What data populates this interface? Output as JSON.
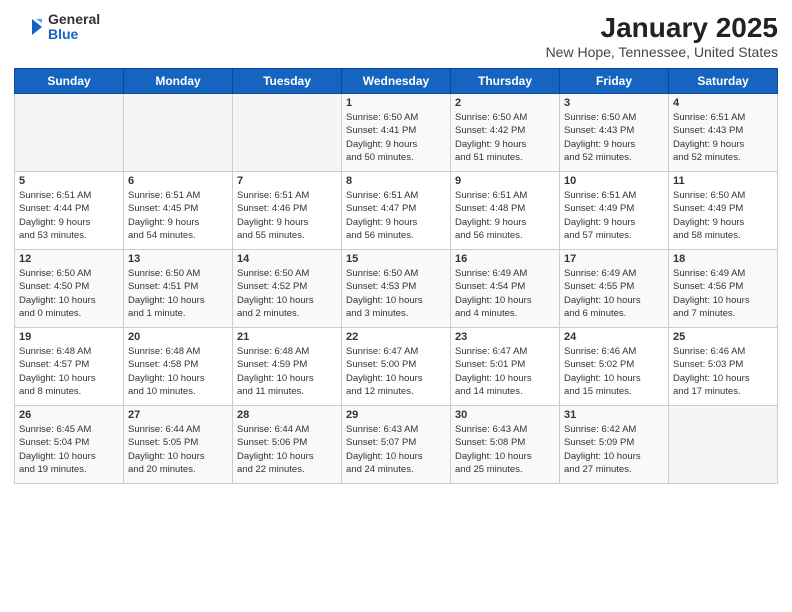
{
  "logo": {
    "general": "General",
    "blue": "Blue"
  },
  "title": "January 2025",
  "subtitle": "New Hope, Tennessee, United States",
  "days_header": [
    "Sunday",
    "Monday",
    "Tuesday",
    "Wednesday",
    "Thursday",
    "Friday",
    "Saturday"
  ],
  "weeks": [
    [
      {
        "day": "",
        "info": ""
      },
      {
        "day": "",
        "info": ""
      },
      {
        "day": "",
        "info": ""
      },
      {
        "day": "1",
        "info": "Sunrise: 6:50 AM\nSunset: 4:41 PM\nDaylight: 9 hours\nand 50 minutes."
      },
      {
        "day": "2",
        "info": "Sunrise: 6:50 AM\nSunset: 4:42 PM\nDaylight: 9 hours\nand 51 minutes."
      },
      {
        "day": "3",
        "info": "Sunrise: 6:50 AM\nSunset: 4:43 PM\nDaylight: 9 hours\nand 52 minutes."
      },
      {
        "day": "4",
        "info": "Sunrise: 6:51 AM\nSunset: 4:43 PM\nDaylight: 9 hours\nand 52 minutes."
      }
    ],
    [
      {
        "day": "5",
        "info": "Sunrise: 6:51 AM\nSunset: 4:44 PM\nDaylight: 9 hours\nand 53 minutes."
      },
      {
        "day": "6",
        "info": "Sunrise: 6:51 AM\nSunset: 4:45 PM\nDaylight: 9 hours\nand 54 minutes."
      },
      {
        "day": "7",
        "info": "Sunrise: 6:51 AM\nSunset: 4:46 PM\nDaylight: 9 hours\nand 55 minutes."
      },
      {
        "day": "8",
        "info": "Sunrise: 6:51 AM\nSunset: 4:47 PM\nDaylight: 9 hours\nand 56 minutes."
      },
      {
        "day": "9",
        "info": "Sunrise: 6:51 AM\nSunset: 4:48 PM\nDaylight: 9 hours\nand 56 minutes."
      },
      {
        "day": "10",
        "info": "Sunrise: 6:51 AM\nSunset: 4:49 PM\nDaylight: 9 hours\nand 57 minutes."
      },
      {
        "day": "11",
        "info": "Sunrise: 6:50 AM\nSunset: 4:49 PM\nDaylight: 9 hours\nand 58 minutes."
      }
    ],
    [
      {
        "day": "12",
        "info": "Sunrise: 6:50 AM\nSunset: 4:50 PM\nDaylight: 10 hours\nand 0 minutes."
      },
      {
        "day": "13",
        "info": "Sunrise: 6:50 AM\nSunset: 4:51 PM\nDaylight: 10 hours\nand 1 minute."
      },
      {
        "day": "14",
        "info": "Sunrise: 6:50 AM\nSunset: 4:52 PM\nDaylight: 10 hours\nand 2 minutes."
      },
      {
        "day": "15",
        "info": "Sunrise: 6:50 AM\nSunset: 4:53 PM\nDaylight: 10 hours\nand 3 minutes."
      },
      {
        "day": "16",
        "info": "Sunrise: 6:49 AM\nSunset: 4:54 PM\nDaylight: 10 hours\nand 4 minutes."
      },
      {
        "day": "17",
        "info": "Sunrise: 6:49 AM\nSunset: 4:55 PM\nDaylight: 10 hours\nand 6 minutes."
      },
      {
        "day": "18",
        "info": "Sunrise: 6:49 AM\nSunset: 4:56 PM\nDaylight: 10 hours\nand 7 minutes."
      }
    ],
    [
      {
        "day": "19",
        "info": "Sunrise: 6:48 AM\nSunset: 4:57 PM\nDaylight: 10 hours\nand 8 minutes."
      },
      {
        "day": "20",
        "info": "Sunrise: 6:48 AM\nSunset: 4:58 PM\nDaylight: 10 hours\nand 10 minutes."
      },
      {
        "day": "21",
        "info": "Sunrise: 6:48 AM\nSunset: 4:59 PM\nDaylight: 10 hours\nand 11 minutes."
      },
      {
        "day": "22",
        "info": "Sunrise: 6:47 AM\nSunset: 5:00 PM\nDaylight: 10 hours\nand 12 minutes."
      },
      {
        "day": "23",
        "info": "Sunrise: 6:47 AM\nSunset: 5:01 PM\nDaylight: 10 hours\nand 14 minutes."
      },
      {
        "day": "24",
        "info": "Sunrise: 6:46 AM\nSunset: 5:02 PM\nDaylight: 10 hours\nand 15 minutes."
      },
      {
        "day": "25",
        "info": "Sunrise: 6:46 AM\nSunset: 5:03 PM\nDaylight: 10 hours\nand 17 minutes."
      }
    ],
    [
      {
        "day": "26",
        "info": "Sunrise: 6:45 AM\nSunset: 5:04 PM\nDaylight: 10 hours\nand 19 minutes."
      },
      {
        "day": "27",
        "info": "Sunrise: 6:44 AM\nSunset: 5:05 PM\nDaylight: 10 hours\nand 20 minutes."
      },
      {
        "day": "28",
        "info": "Sunrise: 6:44 AM\nSunset: 5:06 PM\nDaylight: 10 hours\nand 22 minutes."
      },
      {
        "day": "29",
        "info": "Sunrise: 6:43 AM\nSunset: 5:07 PM\nDaylight: 10 hours\nand 24 minutes."
      },
      {
        "day": "30",
        "info": "Sunrise: 6:43 AM\nSunset: 5:08 PM\nDaylight: 10 hours\nand 25 minutes."
      },
      {
        "day": "31",
        "info": "Sunrise: 6:42 AM\nSunset: 5:09 PM\nDaylight: 10 hours\nand 27 minutes."
      },
      {
        "day": "",
        "info": ""
      }
    ]
  ]
}
